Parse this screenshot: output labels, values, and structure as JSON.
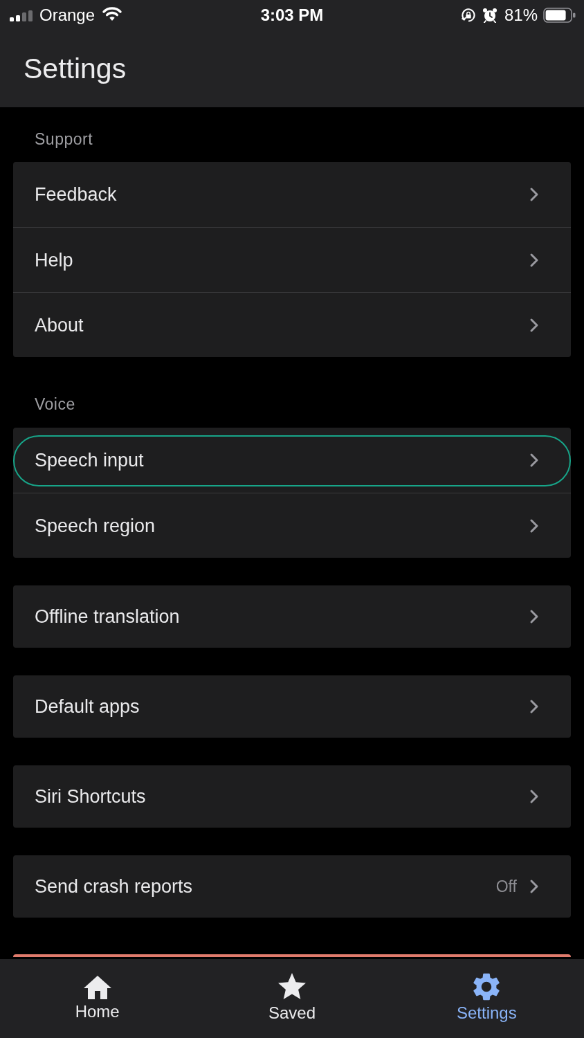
{
  "status_bar": {
    "carrier": "Orange",
    "time": "3:03 PM",
    "battery": "81%"
  },
  "header": {
    "title": "Settings"
  },
  "groups": [
    {
      "title": "Support",
      "items": [
        {
          "label": "Feedback",
          "focused": false
        },
        {
          "label": "Help",
          "focused": false
        },
        {
          "label": "About",
          "focused": false
        }
      ]
    },
    {
      "title": "Voice",
      "items": [
        {
          "label": "Speech input",
          "focused": true
        },
        {
          "label": "Speech region",
          "focused": false
        }
      ]
    },
    {
      "items": [
        {
          "label": "Offline translation",
          "focused": false
        }
      ]
    },
    {
      "items": [
        {
          "label": "Default apps",
          "focused": false
        }
      ]
    },
    {
      "items": [
        {
          "label": "Siri Shortcuts",
          "focused": false
        }
      ]
    },
    {
      "items": [
        {
          "label": "Send crash reports",
          "value": "Off",
          "focused": false
        }
      ]
    }
  ],
  "tab_bar": {
    "tabs": [
      {
        "label": "Home",
        "kind": "home",
        "selected": false
      },
      {
        "label": "Saved",
        "kind": "star",
        "selected": false
      },
      {
        "label": "Settings",
        "kind": "gear",
        "selected": true
      }
    ]
  }
}
